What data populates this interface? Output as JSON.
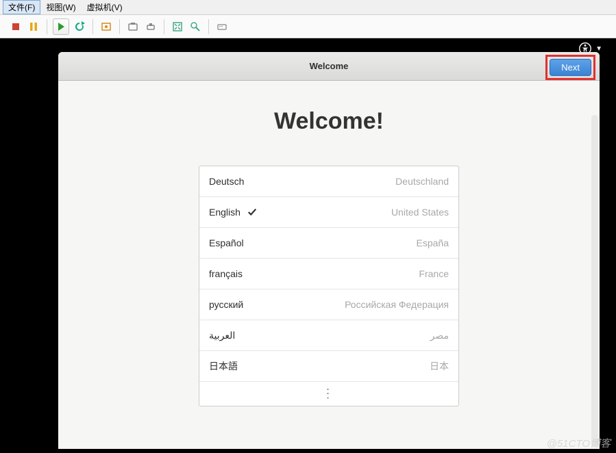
{
  "menubar": {
    "file": "文件(F)",
    "view": "视图(W)",
    "vm": "虚拟机(V)"
  },
  "toolbar": {
    "stop": "stop",
    "pause": "pause",
    "play": "play",
    "refresh": "refresh",
    "snapshot": "snapshot",
    "screenshot": "screenshot",
    "usb": "usb",
    "fullscreen": "fullscreen",
    "scale": "scale",
    "send_key": "send_key"
  },
  "accessibility": {
    "label": "accessibility"
  },
  "titlebar": {
    "title": "Welcome"
  },
  "next_button": {
    "label": "Next"
  },
  "heading": "Welcome!",
  "languages": [
    {
      "name": "Deutsch",
      "country": "Deutschland",
      "selected": false
    },
    {
      "name": "English",
      "country": "United States",
      "selected": true
    },
    {
      "name": "Español",
      "country": "España",
      "selected": false
    },
    {
      "name": "français",
      "country": "France",
      "selected": false
    },
    {
      "name": "русский",
      "country": "Российская Федерация",
      "selected": false
    },
    {
      "name": "العربية",
      "country": "مصر",
      "selected": false
    },
    {
      "name": "日本語",
      "country": "日本",
      "selected": false
    }
  ],
  "more_indicator": "⋮",
  "watermark": "@51CTO博客"
}
